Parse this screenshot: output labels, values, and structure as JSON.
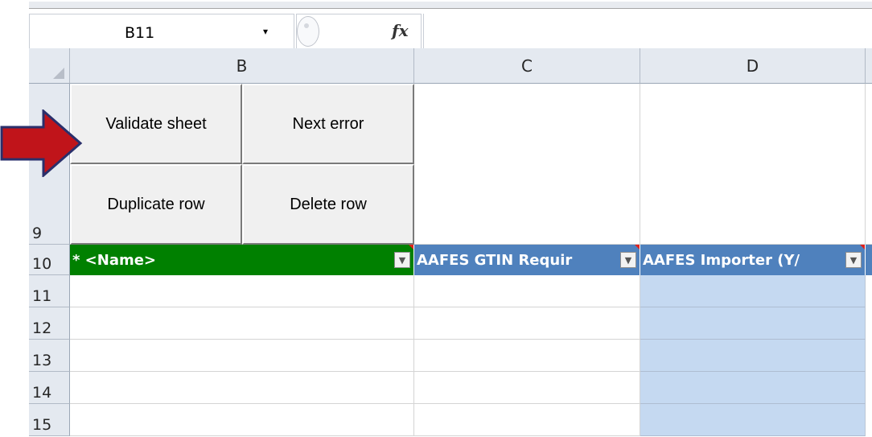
{
  "formula_bar": {
    "cell_reference": "B11",
    "dropdown_glyph": "▾",
    "fx_label": "fx",
    "formula": ""
  },
  "columns": [
    {
      "id": "B",
      "label": "B"
    },
    {
      "id": "C",
      "label": "C"
    },
    {
      "id": "D",
      "label": "D"
    }
  ],
  "rows": [
    "9",
    "10",
    "11",
    "12",
    "13",
    "14",
    "15"
  ],
  "macro_buttons": {
    "validate": "Validate sheet",
    "next_error": "Next error",
    "duplicate_row": "Duplicate row",
    "delete_row": "Delete row"
  },
  "table_headers": {
    "b": "* <Name>",
    "c": "AAFES GTIN Requir",
    "d": "AAFES Importer (Y/"
  },
  "filter_glyph": "▼",
  "colors": {
    "name_header": "#008000",
    "field_header": "#4f81bd",
    "highlight_column": "#c5d9f1",
    "arrow": "#c0141a"
  },
  "icons": [
    "fx-icon",
    "dropdown-icon",
    "filter-icon",
    "arrow-icon"
  ]
}
